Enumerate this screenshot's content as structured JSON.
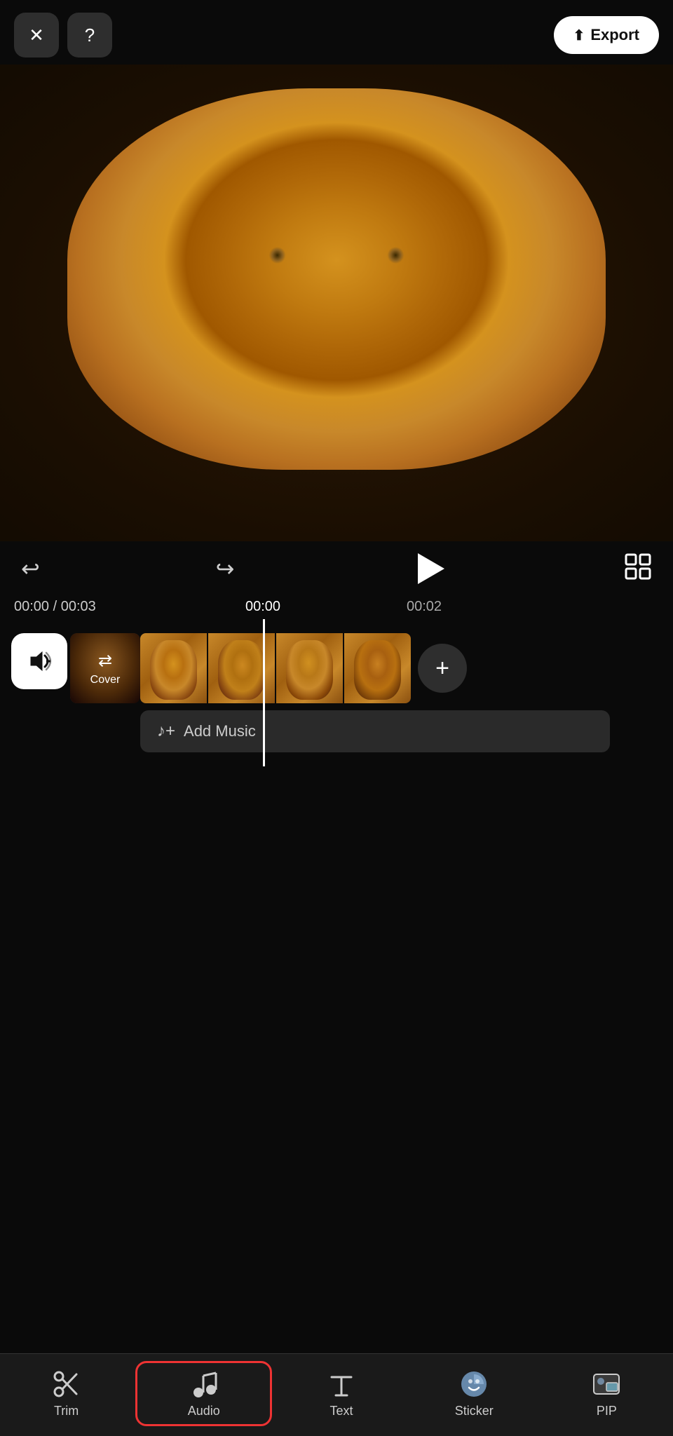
{
  "topbar": {
    "close_label": "✕",
    "help_label": "?",
    "export_label": "Export"
  },
  "controls": {
    "undo_label": "↩",
    "redo_label": "↪"
  },
  "timeline": {
    "current_time": "00:00",
    "total_time": "00:03",
    "marker1_time": "00:00",
    "marker2_time": "00:02"
  },
  "track": {
    "cover_label": "Cover",
    "add_music_label": "Add Music"
  },
  "bottomnav": {
    "trim_label": "Trim",
    "audio_label": "Audio",
    "text_label": "Text",
    "sticker_label": "Sticker",
    "pip_label": "PIP"
  }
}
